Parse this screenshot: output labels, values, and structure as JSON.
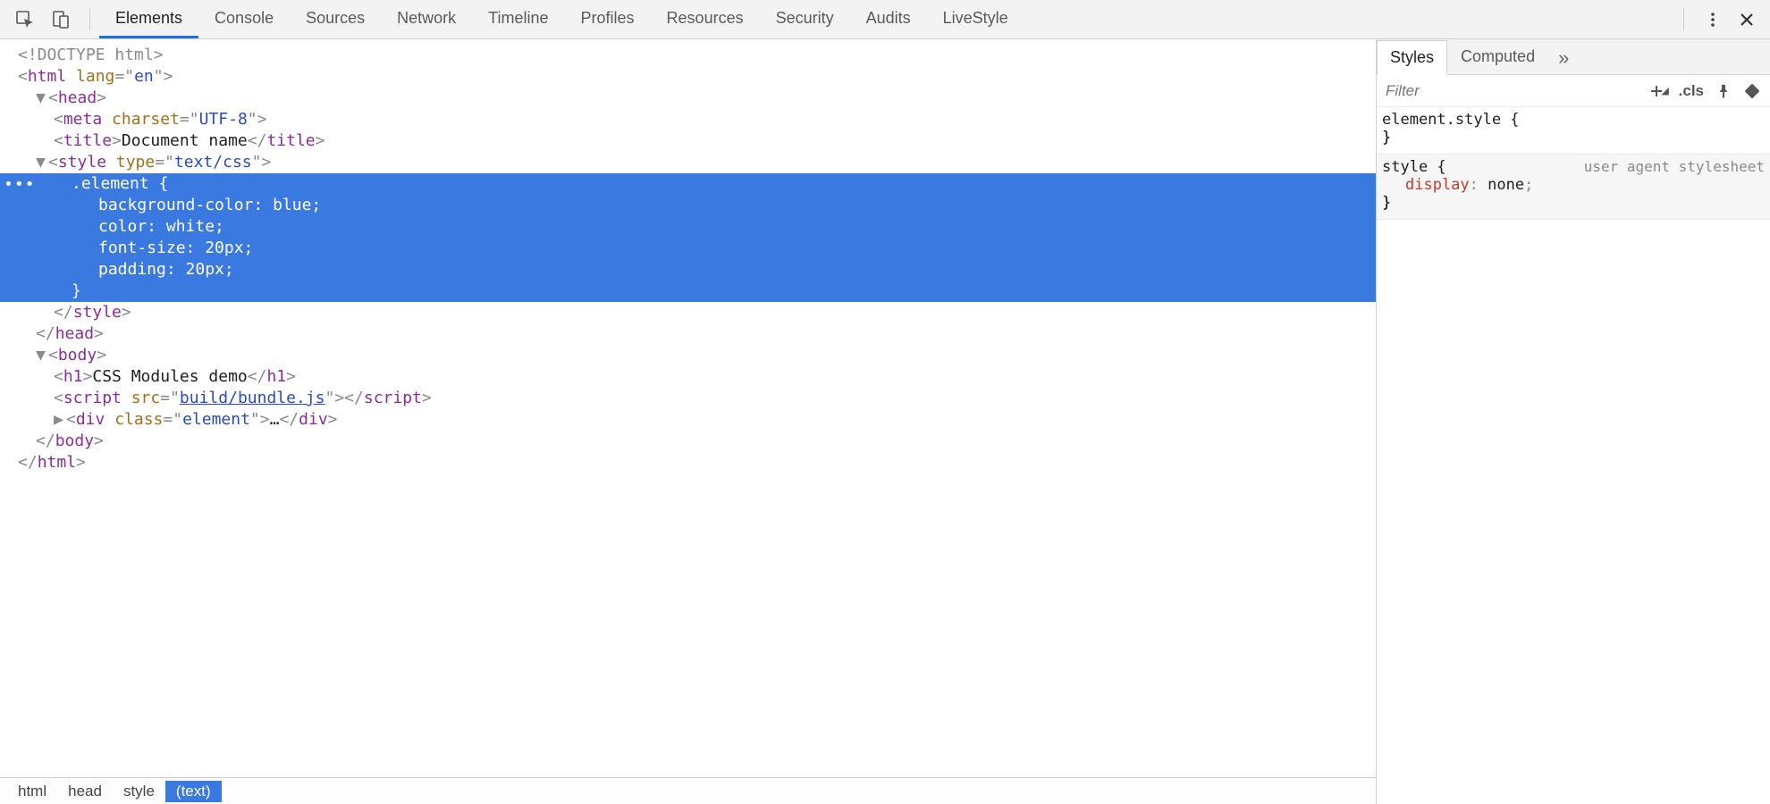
{
  "toolbar": {
    "tabs": [
      "Elements",
      "Console",
      "Sources",
      "Network",
      "Timeline",
      "Profiles",
      "Resources",
      "Security",
      "Audits",
      "LiveStyle"
    ],
    "activeTab": "Elements"
  },
  "tree": {
    "doctype": "<!DOCTYPE html>",
    "html_open": "<html lang=\"en\">",
    "head_open": "<head>",
    "meta": "<meta charset=\"UTF-8\">",
    "title_open": "<title>",
    "title_text": "Document name",
    "title_close": "</title>",
    "style_open": "<style type=\"text/css\">",
    "css_sel": ".element {",
    "css_l1": "background-color: blue;",
    "css_l2": "color: white;",
    "css_l3": "font-size: 20px;",
    "css_l4": "padding: 20px;",
    "css_close": "}",
    "style_close": "</style>",
    "head_close": "</head>",
    "body_open": "<body>",
    "h1_open": "<h1>",
    "h1_text": "CSS Modules demo",
    "h1_close": "</h1>",
    "script_open_before": "<script src=\"",
    "script_src": "build/bundle.js",
    "script_open_after": "\">",
    "script_close_tag": "script",
    "div_line": "<div class=\"element\">…</div>",
    "body_close": "</body>",
    "html_close": "</html>"
  },
  "breadcrumb": [
    "html",
    "head",
    "style",
    "(text)"
  ],
  "sidebar": {
    "tabs": [
      "Styles",
      "Computed"
    ],
    "activeTab": "Styles",
    "filter_placeholder": "Filter",
    "cls_label": ".cls",
    "element_style": "element.style {",
    "brace_close": "}",
    "ua_selector": "style {",
    "ua_label": "user agent stylesheet",
    "ua_prop_name": "display",
    "ua_prop_value": "none"
  }
}
